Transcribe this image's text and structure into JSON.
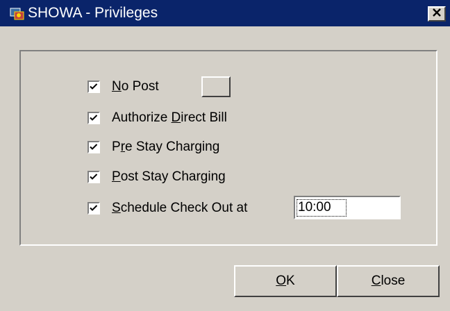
{
  "window": {
    "title": "SHOWA - Privileges",
    "title_icon": "app-icon",
    "close_glyph": "X",
    "colors": {
      "title_bar": "#0a246a",
      "face": "#d4d0c8"
    }
  },
  "options": [
    {
      "accel": "N",
      "rest": "o Post",
      "checked": true
    },
    {
      "pre": "Authorize ",
      "accel": "D",
      "rest": "irect Bill",
      "checked": true
    },
    {
      "pre": "P",
      "accel": "r",
      "rest": "e Stay Charging",
      "checked": true
    },
    {
      "accel": "P",
      "rest": "ost Stay Charging",
      "checked": true
    },
    {
      "accel": "S",
      "rest": "chedule Check Out at",
      "checked": true
    }
  ],
  "checkout_time": {
    "value": "10:00"
  },
  "buttons": {
    "ok": {
      "accel": "O",
      "rest": "K"
    },
    "close": {
      "accel": "C",
      "rest": "lose"
    }
  }
}
